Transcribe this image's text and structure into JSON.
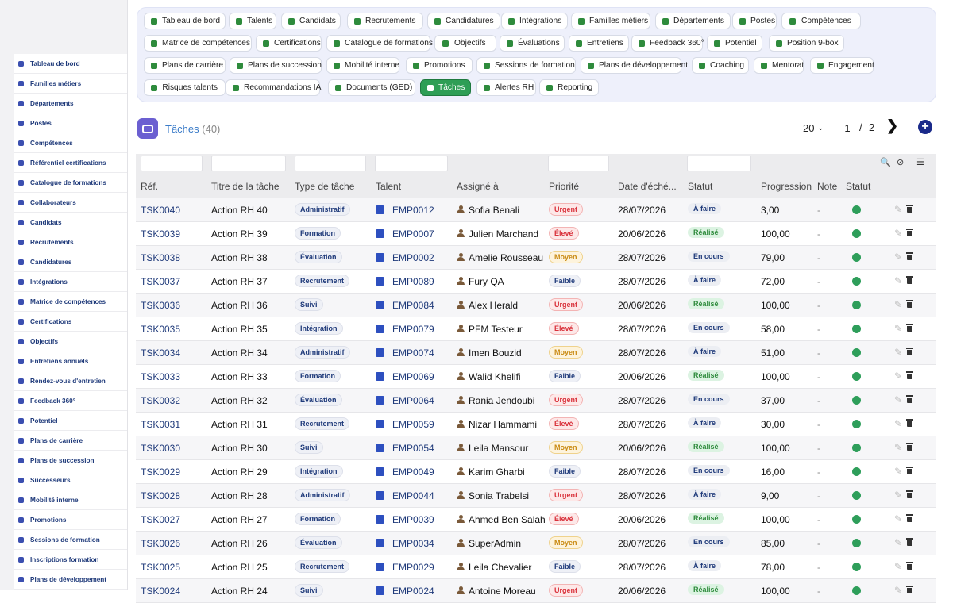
{
  "sidebar": {
    "items": [
      {
        "label": "Tableau de bord",
        "icon": "dashboard-icon"
      },
      {
        "label": "Familles métiers",
        "icon": "sitemap-icon"
      },
      {
        "label": "Départements",
        "icon": "building-icon"
      },
      {
        "label": "Postes",
        "icon": "id-badge-icon"
      },
      {
        "label": "Compétences",
        "icon": "brain-icon"
      },
      {
        "label": "Référentiel certifications",
        "icon": "certificate-icon"
      },
      {
        "label": "Catalogue de formations",
        "icon": "graduation-cap-icon"
      },
      {
        "label": "Collaborateurs",
        "icon": "user-icon"
      },
      {
        "label": "Candidats",
        "icon": "user-plus-icon"
      },
      {
        "label": "Recrutements",
        "icon": "megaphone-icon"
      },
      {
        "label": "Candidatures",
        "icon": "file-icon"
      },
      {
        "label": "Intégrations",
        "icon": "door-icon"
      },
      {
        "label": "Matrice de compétences",
        "icon": "sitemap-icon"
      },
      {
        "label": "Certifications",
        "icon": "award-icon"
      },
      {
        "label": "Objectifs",
        "icon": "target-icon"
      },
      {
        "label": "Entretiens annuels",
        "icon": "star-icon"
      },
      {
        "label": "Rendez-vous d'entretien",
        "icon": "handshake-icon"
      },
      {
        "label": "Feedback 360°",
        "icon": "comment-icon"
      },
      {
        "label": "Potentiel",
        "icon": "chart-line-icon"
      },
      {
        "label": "Plans de carrière",
        "icon": "route-icon"
      },
      {
        "label": "Plans de succession",
        "icon": "sitemap-icon"
      },
      {
        "label": "Successeurs",
        "icon": "users-icon"
      },
      {
        "label": "Mobilité interne",
        "icon": "exchange-icon"
      },
      {
        "label": "Promotions",
        "icon": "arrow-up-icon"
      },
      {
        "label": "Sessions de formation",
        "icon": "chalkboard-icon"
      },
      {
        "label": "Inscriptions formation",
        "icon": "user-check-icon"
      },
      {
        "label": "Plans de développement",
        "icon": "clipboard-icon"
      }
    ]
  },
  "topmenu": {
    "items": [
      {
        "label": "Tableau de bord",
        "icon": "dashboard-icon",
        "active": false
      },
      {
        "label": "Talents",
        "icon": "user-icon",
        "active": false
      },
      {
        "label": "Candidats",
        "icon": "user-plus-icon",
        "active": false
      },
      {
        "label": "Recrutements",
        "icon": "megaphone-icon",
        "active": false
      },
      {
        "label": "Candidatures",
        "icon": "file-icon",
        "active": false
      },
      {
        "label": "Intégrations",
        "icon": "door-icon",
        "active": false
      },
      {
        "label": "Familles métiers",
        "icon": "sitemap-icon",
        "active": false
      },
      {
        "label": "Départements",
        "icon": "building-icon",
        "active": false
      },
      {
        "label": "Postes",
        "icon": "id-badge-icon",
        "active": false
      },
      {
        "label": "Compétences",
        "icon": "brain-icon",
        "active": false
      },
      {
        "label": "Matrice de compétences",
        "icon": "sitemap-icon",
        "active": false
      },
      {
        "label": "Certifications",
        "icon": "award-icon",
        "active": false
      },
      {
        "label": "Catalogue de formations",
        "icon": "graduation-cap-icon",
        "active": false
      },
      {
        "label": "Objectifs",
        "icon": "target-icon",
        "active": false
      },
      {
        "label": "Évaluations",
        "icon": "star-icon",
        "active": false
      },
      {
        "label": "Entretiens",
        "icon": "handshake-icon",
        "active": false
      },
      {
        "label": "Feedback 360°",
        "icon": "comment-icon",
        "active": false
      },
      {
        "label": "Potentiel",
        "icon": "chart-line-icon",
        "active": false
      },
      {
        "label": "Position 9-box",
        "icon": "grid-icon",
        "active": false
      },
      {
        "label": "Plans de carrière",
        "icon": "route-icon",
        "active": false
      },
      {
        "label": "Plans de succession",
        "icon": "sitemap-icon",
        "active": false
      },
      {
        "label": "Mobilité interne",
        "icon": "exchange-icon",
        "active": false
      },
      {
        "label": "Promotions",
        "icon": "arrow-up-icon",
        "active": false
      },
      {
        "label": "Sessions de formation",
        "icon": "chalkboard-icon",
        "active": false
      },
      {
        "label": "Plans de développement",
        "icon": "clipboard-icon",
        "active": false
      },
      {
        "label": "Coaching",
        "icon": "hands-icon",
        "active": false
      },
      {
        "label": "Mentorat",
        "icon": "user-tie-icon",
        "active": false
      },
      {
        "label": "Engagement",
        "icon": "heart-icon",
        "active": false
      },
      {
        "label": "Risques talents",
        "icon": "warning-icon",
        "active": false
      },
      {
        "label": "Recommandations IA",
        "icon": "robot-icon",
        "active": false
      },
      {
        "label": "Documents (GED)",
        "icon": "folder-icon",
        "active": false
      },
      {
        "label": "Tâches",
        "icon": "list-check-icon",
        "active": true
      },
      {
        "label": "Alertes RH",
        "icon": "bell-icon",
        "active": false
      },
      {
        "label": "Reporting",
        "icon": "chart-pie-icon",
        "active": false
      }
    ]
  },
  "header": {
    "title": "Tâches",
    "count": "(40)",
    "page_size": "20",
    "current_page": "1",
    "separator": "/",
    "total_pages": "2"
  },
  "table": {
    "columns": [
      "Réf.",
      "Titre de la tâche",
      "Type de tâche",
      "Talent",
      "Assigné à",
      "Priorité",
      "Date d'éché...",
      "Statut",
      "Progression",
      "Note",
      "Statut"
    ],
    "rows": [
      {
        "ref": "TSK0040",
        "title": "Action RH 40",
        "type": "Administratif",
        "talent": "EMP0012",
        "assignee": "Sofia Benali",
        "priority": "Urgent",
        "date": "28/07/2026",
        "status": "À faire",
        "progress": "3,00",
        "note": "-"
      },
      {
        "ref": "TSK0039",
        "title": "Action RH 39",
        "type": "Formation",
        "talent": "EMP0007",
        "assignee": "Julien Marchand",
        "priority": "Élevé",
        "date": "20/06/2026",
        "status": "Réalisé",
        "progress": "100,00",
        "note": "-"
      },
      {
        "ref": "TSK0038",
        "title": "Action RH 38",
        "type": "Évaluation",
        "talent": "EMP0002",
        "assignee": "Amelie Rousseau",
        "priority": "Moyen",
        "date": "28/07/2026",
        "status": "En cours",
        "progress": "79,00",
        "note": "-"
      },
      {
        "ref": "TSK0037",
        "title": "Action RH 37",
        "type": "Recrutement",
        "talent": "EMP0089",
        "assignee": "Fury QA",
        "priority": "Faible",
        "date": "28/07/2026",
        "status": "À faire",
        "progress": "72,00",
        "note": "-"
      },
      {
        "ref": "TSK0036",
        "title": "Action RH 36",
        "type": "Suivi",
        "talent": "EMP0084",
        "assignee": "Alex Herald",
        "priority": "Urgent",
        "date": "20/06/2026",
        "status": "Réalisé",
        "progress": "100,00",
        "note": "-"
      },
      {
        "ref": "TSK0035",
        "title": "Action RH 35",
        "type": "Intégration",
        "talent": "EMP0079",
        "assignee": "PFM Testeur",
        "priority": "Élevé",
        "date": "28/07/2026",
        "status": "En cours",
        "progress": "58,00",
        "note": "-"
      },
      {
        "ref": "TSK0034",
        "title": "Action RH 34",
        "type": "Administratif",
        "talent": "EMP0074",
        "assignee": "Imen Bouzid",
        "priority": "Moyen",
        "date": "28/07/2026",
        "status": "À faire",
        "progress": "51,00",
        "note": "-"
      },
      {
        "ref": "TSK0033",
        "title": "Action RH 33",
        "type": "Formation",
        "talent": "EMP0069",
        "assignee": "Walid Khelifi",
        "priority": "Faible",
        "date": "20/06/2026",
        "status": "Réalisé",
        "progress": "100,00",
        "note": "-"
      },
      {
        "ref": "TSK0032",
        "title": "Action RH 32",
        "type": "Évaluation",
        "talent": "EMP0064",
        "assignee": "Rania Jendoubi",
        "priority": "Urgent",
        "date": "28/07/2026",
        "status": "En cours",
        "progress": "37,00",
        "note": "-"
      },
      {
        "ref": "TSK0031",
        "title": "Action RH 31",
        "type": "Recrutement",
        "talent": "EMP0059",
        "assignee": "Nizar Hammami",
        "priority": "Élevé",
        "date": "28/07/2026",
        "status": "À faire",
        "progress": "30,00",
        "note": "-"
      },
      {
        "ref": "TSK0030",
        "title": "Action RH 30",
        "type": "Suivi",
        "talent": "EMP0054",
        "assignee": "Leila Mansour",
        "priority": "Moyen",
        "date": "20/06/2026",
        "status": "Réalisé",
        "progress": "100,00",
        "note": "-"
      },
      {
        "ref": "TSK0029",
        "title": "Action RH 29",
        "type": "Intégration",
        "talent": "EMP0049",
        "assignee": "Karim Gharbi",
        "priority": "Faible",
        "date": "28/07/2026",
        "status": "En cours",
        "progress": "16,00",
        "note": "-"
      },
      {
        "ref": "TSK0028",
        "title": "Action RH 28",
        "type": "Administratif",
        "talent": "EMP0044",
        "assignee": "Sonia Trabelsi",
        "priority": "Urgent",
        "date": "28/07/2026",
        "status": "À faire",
        "progress": "9,00",
        "note": "-"
      },
      {
        "ref": "TSK0027",
        "title": "Action RH 27",
        "type": "Formation",
        "talent": "EMP0039",
        "assignee": "Ahmed Ben Salah",
        "priority": "Élevé",
        "date": "20/06/2026",
        "status": "Réalisé",
        "progress": "100,00",
        "note": "-"
      },
      {
        "ref": "TSK0026",
        "title": "Action RH 26",
        "type": "Évaluation",
        "talent": "EMP0034",
        "assignee": "SuperAdmin",
        "priority": "Moyen",
        "date": "28/07/2026",
        "status": "En cours",
        "progress": "85,00",
        "note": "-"
      },
      {
        "ref": "TSK0025",
        "title": "Action RH 25",
        "type": "Recrutement",
        "talent": "EMP0029",
        "assignee": "Leila Chevalier",
        "priority": "Faible",
        "date": "28/07/2026",
        "status": "À faire",
        "progress": "78,00",
        "note": "-"
      },
      {
        "ref": "TSK0024",
        "title": "Action RH 24",
        "type": "Suivi",
        "talent": "EMP0024",
        "assignee": "Antoine Moreau",
        "priority": "Urgent",
        "date": "20/06/2026",
        "status": "Réalisé",
        "progress": "100,00",
        "note": "-"
      }
    ]
  },
  "colors": {
    "accent": "#2e9e55",
    "link": "#1f3a7a",
    "priority_urgent": "#d9323c",
    "priority_eleve": "#d9323c",
    "priority_moyen": "#c98a12",
    "priority_faible": "#1f3a7a",
    "status_afaire": "#1f3a7a",
    "status_realise": "#2e8b3c",
    "status_encours": "#1f3a7a",
    "active_dot": "#2e9e5a"
  }
}
